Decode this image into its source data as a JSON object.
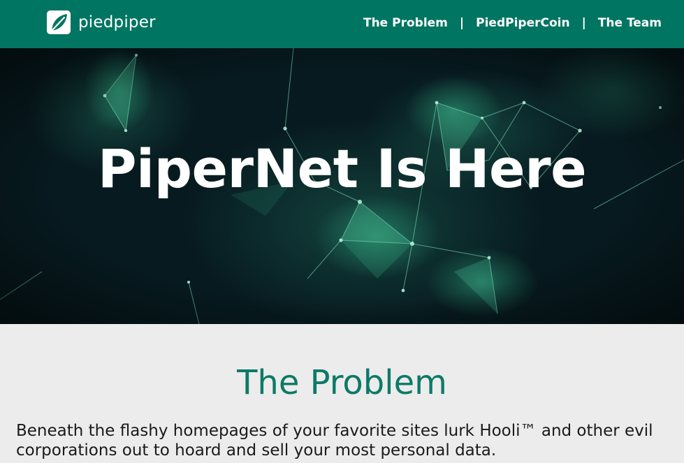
{
  "header": {
    "brand": "piedpiper",
    "logo_icon": "leaf-logo-icon",
    "nav": [
      {
        "label": "The Problem"
      },
      {
        "label": "PiedPiperCoin"
      },
      {
        "label": "The Team"
      }
    ],
    "separator": "|"
  },
  "hero": {
    "title": "PiperNet Is Here",
    "background": "network-mesh-image"
  },
  "problem": {
    "title": "The Problem",
    "body": "Beneath the flashy homepages of your favorite sites lurk Hooli™ and other evil corporations out to hoard and sell your most personal data."
  },
  "colors": {
    "brand_green": "#007562",
    "heading_green": "#0c7a66",
    "section_bg": "#ececec",
    "hero_bg": "#06141a"
  }
}
